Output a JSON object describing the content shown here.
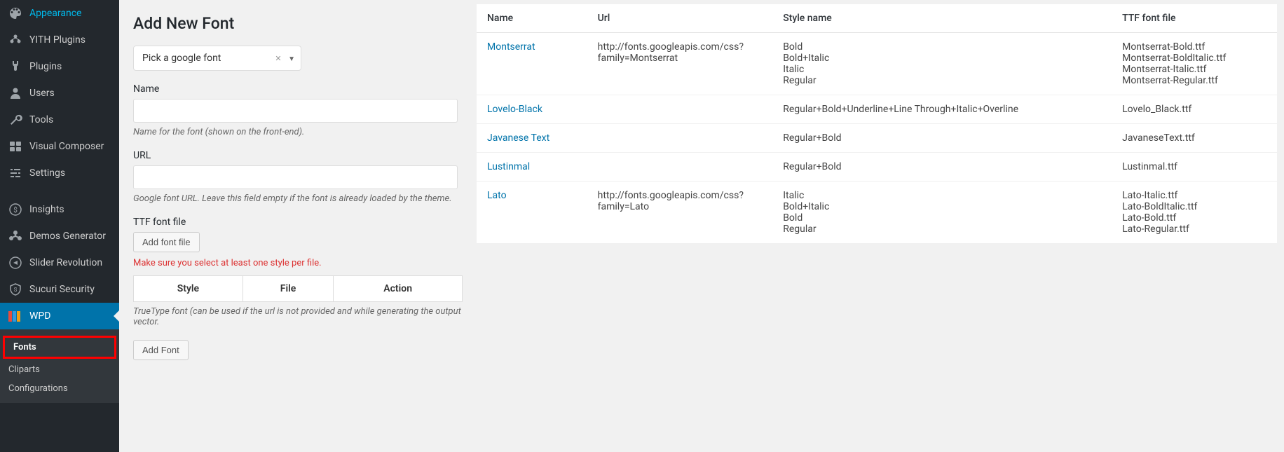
{
  "sidebar": {
    "items": [
      {
        "label": "Appearance",
        "icon": "appearance"
      },
      {
        "label": "YITH Plugins",
        "icon": "yith"
      },
      {
        "label": "Plugins",
        "icon": "plugins"
      },
      {
        "label": "Users",
        "icon": "users"
      },
      {
        "label": "Tools",
        "icon": "tools"
      },
      {
        "label": "Visual Composer",
        "icon": "visual-composer"
      },
      {
        "label": "Settings",
        "icon": "settings"
      },
      {
        "label": "Insights",
        "icon": "insights"
      },
      {
        "label": "Demos Generator",
        "icon": "demos"
      },
      {
        "label": "Slider Revolution",
        "icon": "slider"
      },
      {
        "label": "Sucuri Security",
        "icon": "sucuri"
      },
      {
        "label": "WPD",
        "icon": "wpd"
      }
    ],
    "submenu": [
      {
        "label": "Fonts"
      },
      {
        "label": "Cliparts"
      },
      {
        "label": "Configurations"
      }
    ]
  },
  "form": {
    "heading": "Add New Font",
    "font_select_placeholder": "Pick a google font",
    "name_label": "Name",
    "name_desc": "Name for the font (shown on the front-end).",
    "url_label": "URL",
    "url_desc": "Google font URL. Leave this field empty if the font is already loaded by the theme.",
    "ttf_label": "TTF font file",
    "add_file_btn": "Add font file",
    "validation": "Make sure you select at least one style per file.",
    "sub_table": {
      "style": "Style",
      "file": "File",
      "action": "Action"
    },
    "ttf_desc": "TrueType font (can be used if the url is not provided and while generating the output vector.",
    "submit_btn": "Add Font"
  },
  "table": {
    "headers": {
      "name": "Name",
      "url": "Url",
      "style_name": "Style name",
      "ttf": "TTF font file"
    },
    "rows": [
      {
        "name": "Montserrat",
        "url": "http://fonts.googleapis.com/css?family=Montserrat",
        "styles": [
          "Bold",
          "Bold+Italic",
          "Italic",
          "Regular"
        ],
        "ttfs": [
          "Montserrat-Bold.ttf",
          "Montserrat-BoldItalic.ttf",
          "Montserrat-Italic.ttf",
          "Montserrat-Regular.ttf"
        ]
      },
      {
        "name": "Lovelo-Black",
        "url": "",
        "styles": [
          "Regular+Bold+Underline+Line Through+Italic+Overline"
        ],
        "ttfs": [
          "Lovelo_Black.ttf"
        ]
      },
      {
        "name": "Javanese Text",
        "url": "",
        "styles": [
          "Regular+Bold"
        ],
        "ttfs": [
          "JavaneseText.ttf"
        ]
      },
      {
        "name": "Lustinmal",
        "url": "",
        "styles": [
          "Regular+Bold"
        ],
        "ttfs": [
          "Lustinmal.ttf"
        ]
      },
      {
        "name": "Lato",
        "url": "http://fonts.googleapis.com/css?family=Lato",
        "styles": [
          "Italic",
          "Bold+Italic",
          "Bold",
          "Regular"
        ],
        "ttfs": [
          "Lato-Italic.ttf",
          "Lato-BoldItalic.ttf",
          "Lato-Bold.ttf",
          "Lato-Regular.ttf"
        ]
      }
    ]
  }
}
